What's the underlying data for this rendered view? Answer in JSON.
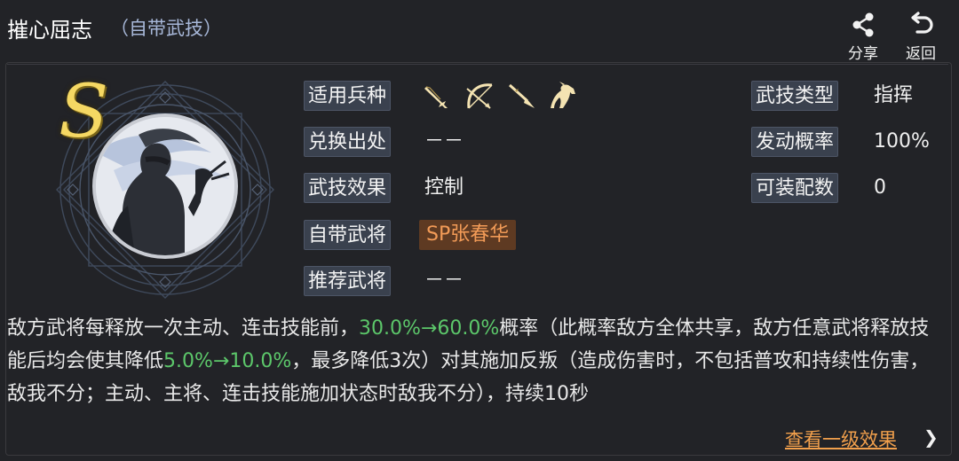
{
  "header": {
    "title": "摧心屈志",
    "subtitle": "（自带武技）",
    "share_label": "分享",
    "back_label": "返回"
  },
  "skill": {
    "grade": "S",
    "labels": {
      "troop_types": "适用兵种",
      "source": "兑换出处",
      "effect": "武技效果",
      "own_general": "自带武将",
      "recommended": "推荐武将",
      "skill_type": "武技类型",
      "trigger_rate": "发动概率",
      "equip_count": "可装配数"
    },
    "values": {
      "source": "－－",
      "effect": "控制",
      "own_general": "SP张春华",
      "recommended": "－－",
      "skill_type": "指挥",
      "trigger_rate": "100%",
      "equip_count": "0"
    },
    "troop_icons": [
      "sword-icon",
      "bow-icon",
      "spear-icon",
      "horse-icon"
    ]
  },
  "description": {
    "p1": "敌方武将每释放一次主动、连击技能前，",
    "h1": "30.0%→60.0%",
    "p2": "概率（此概率敌方全体共享，敌方任意武将释放技能后均会使其降低",
    "h2": "5.0%→10.0%",
    "p3": "，最多降低3次）对其施加反叛（造成伤害时，不包括普攻和持续性伤害，敌我不分；主动、主将、连击技能施加状态时敌我不分），持续10秒"
  },
  "footer": {
    "view_level1": "查看一级效果",
    "arrow": "❯"
  },
  "colors": {
    "highlight": "#5cc76a",
    "general_badge": "#f29b57",
    "link": "#f2a04c",
    "grade": "#f5d863"
  }
}
